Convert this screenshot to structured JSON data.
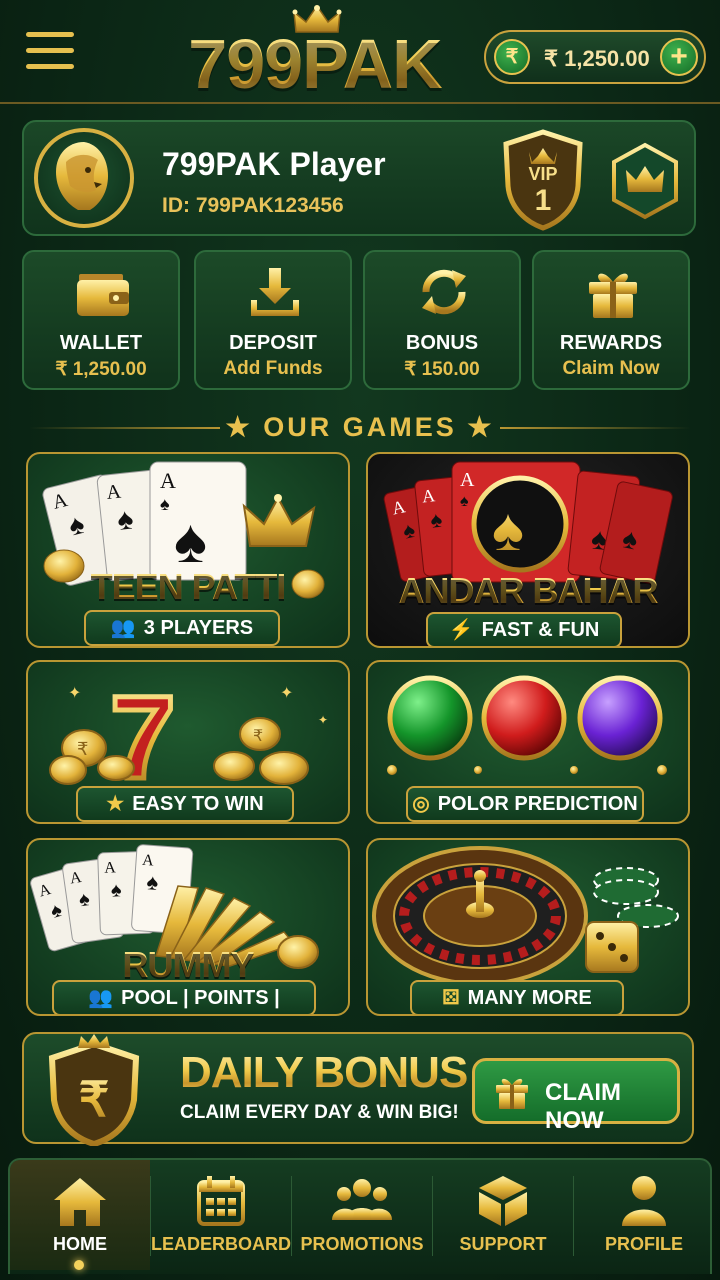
{
  "header": {
    "logo": "799PAK",
    "balance": "₹ 1,250.00",
    "currency_symbol": "₹",
    "add_symbol": "+"
  },
  "profile": {
    "name": "799PAK Player",
    "id": "ID: 799PAK123456",
    "vip_label": "VIP",
    "vip_level": "1"
  },
  "quick_actions": [
    {
      "title": "WALLET",
      "sub": "₹ 1,250.00",
      "icon": "wallet-icon"
    },
    {
      "title": "DEPOSIT",
      "sub": "Add Funds",
      "icon": "download-icon"
    },
    {
      "title": "BONUS",
      "sub": "₹ 150.00",
      "icon": "refresh-icon"
    },
    {
      "title": "REWARDS",
      "sub": "Claim Now",
      "icon": "gift-icon"
    }
  ],
  "section": {
    "title": "★ OUR GAMES ★"
  },
  "games": [
    {
      "title": "TEEN PATTI",
      "tag": "3 PLAYERS",
      "tag_icon": "users-icon"
    },
    {
      "title": "ANDAR BAHAR",
      "tag": "FAST & FUN",
      "tag_icon": "bolt-icon"
    },
    {
      "title": "",
      "tag": "EASY TO WIN",
      "tag_icon": "star-icon"
    },
    {
      "title": "",
      "tag": "POLOR PREDICTION",
      "tag_icon": "target-icon"
    },
    {
      "title": "RUMMY",
      "tag": "POOL | POINTS | DEALS",
      "tag_icon": "users-icon"
    },
    {
      "title": "",
      "tag": "MANY MORE",
      "tag_icon": "dice-icon"
    }
  ],
  "daily_bonus": {
    "title": "DAILY BONUS",
    "subtitle": "CLAIM EVERY DAY & WIN BIG!",
    "button": "CLAIM NOW",
    "currency_symbol": "₹"
  },
  "nav": [
    {
      "label": "HOME",
      "icon": "home-icon",
      "active": true
    },
    {
      "label": "LEADERBOARD",
      "icon": "calendar-icon"
    },
    {
      "label": "PROMOTIONS",
      "icon": "group-icon"
    },
    {
      "label": "SUPPORT",
      "icon": "box-icon"
    },
    {
      "label": "PROFILE",
      "icon": "person-icon"
    }
  ],
  "colors": {
    "background": "#0b2615",
    "gold": "#e7c04f",
    "green_button": "#2f9a44",
    "card_border": "#b99632"
  },
  "chips": {
    "rupee": "₹",
    "seven": "7",
    "card_rank": "A"
  }
}
